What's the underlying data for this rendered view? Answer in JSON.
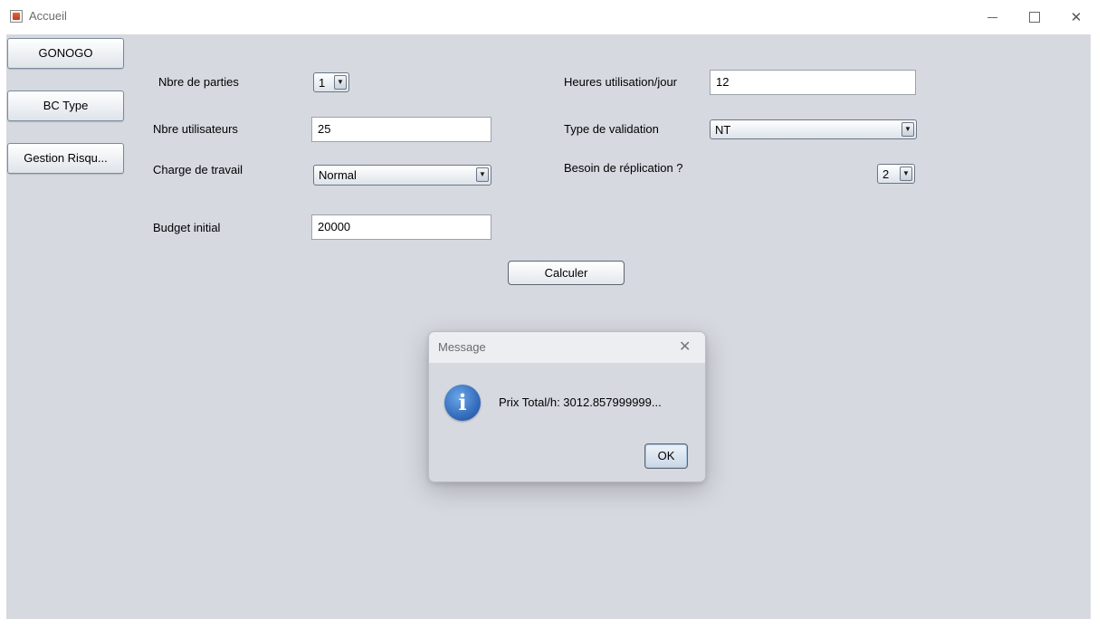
{
  "window": {
    "title": "Accueil"
  },
  "sidebar": {
    "items": [
      {
        "label": "GONOGO"
      },
      {
        "label": "BC Type"
      },
      {
        "label": "Gestion Risqu..."
      }
    ]
  },
  "form": {
    "parties_label": "Nbre de parties",
    "parties_value": "1",
    "utilisateurs_label": "Nbre utilisateurs",
    "utilisateurs_value": "25",
    "charge_label": "Charge de travail",
    "charge_value": "Normal",
    "budget_label": "Budget initial",
    "budget_value": "20000",
    "heures_label": "Heures utilisation/jour",
    "heures_value": "12",
    "validation_label": "Type de validation",
    "validation_value": "NT",
    "replication_label": "Besoin de réplication ?",
    "replication_value": "2",
    "calculate_label": "Calculer"
  },
  "dialog": {
    "title": "Message",
    "message": "Prix Total/h: 3012.857999999...",
    "ok_label": "OK"
  },
  "icons": {
    "app": "java-cup-icon",
    "dropdown": "triangle-down-icon",
    "info": "info-icon"
  }
}
